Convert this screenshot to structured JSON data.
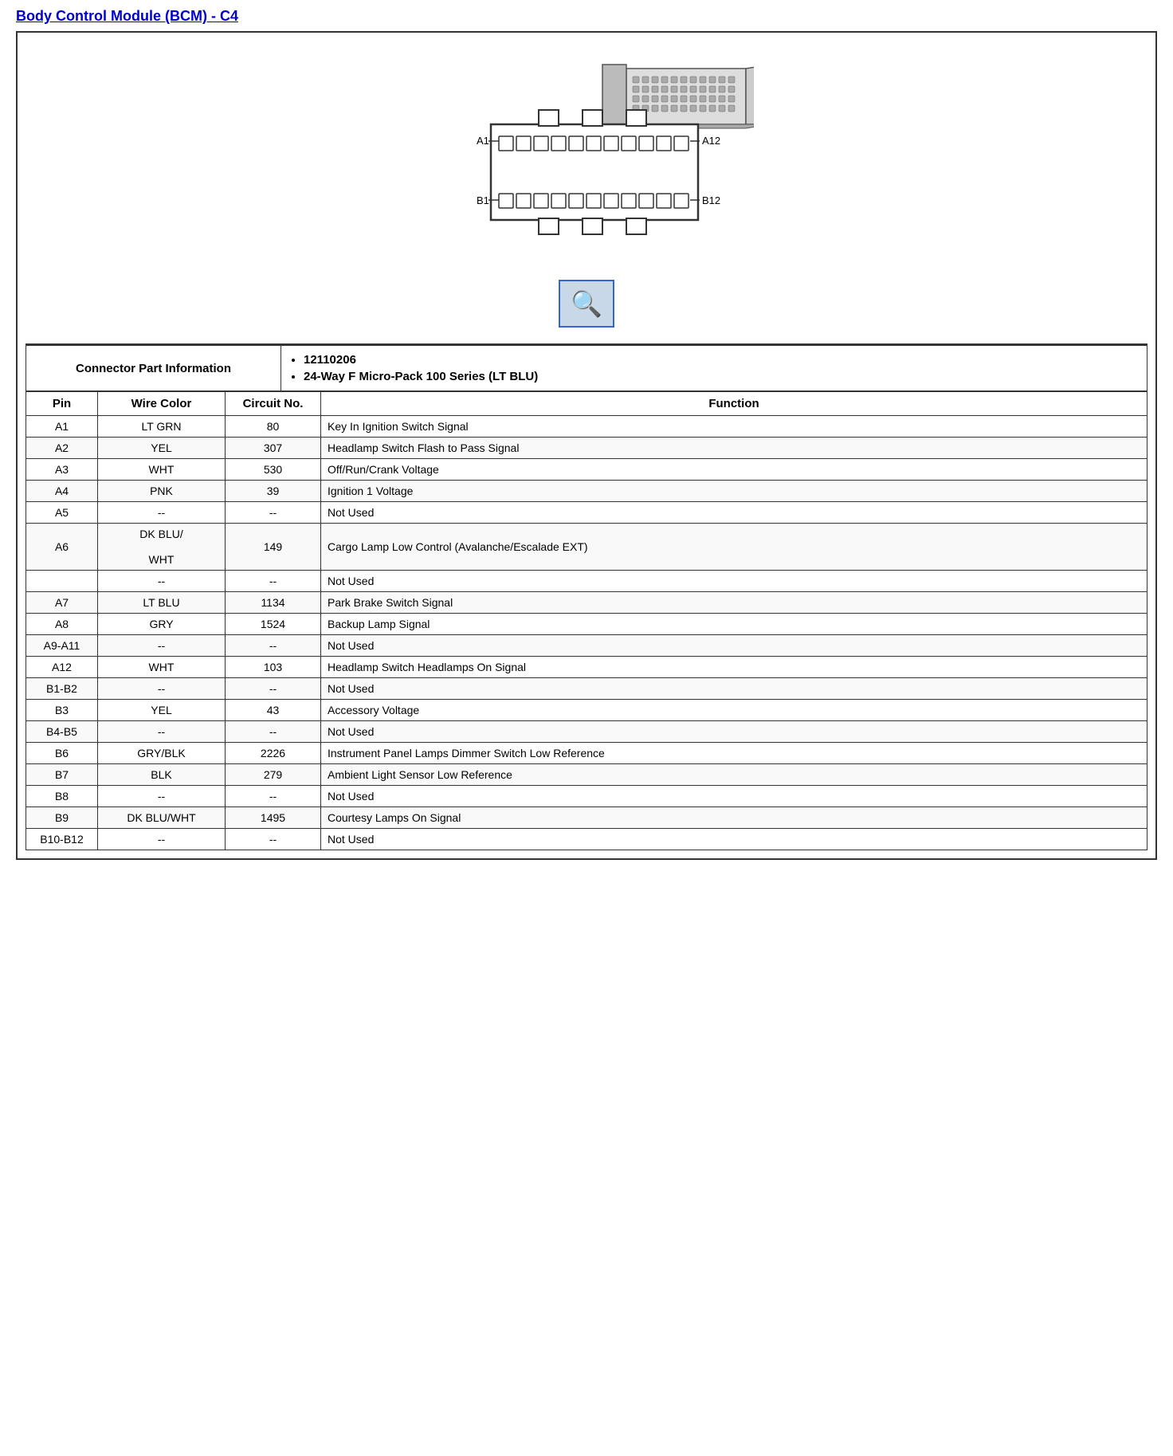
{
  "title": "Body Control Module (BCM) - C4",
  "connector_info_label": "Connector Part Information",
  "connector_details": [
    "12110206",
    "24-Way F Micro-Pack 100 Series (LT BLU)"
  ],
  "table_headers": {
    "pin": "Pin",
    "wire_color": "Wire Color",
    "circuit_no": "Circuit No.",
    "function": "Function"
  },
  "rows": [
    {
      "pin": "A1",
      "wire": "LT GRN",
      "circuit": "80",
      "func": "Key In Ignition Switch Signal"
    },
    {
      "pin": "A2",
      "wire": "YEL",
      "circuit": "307",
      "func": "Headlamp Switch Flash to Pass Signal"
    },
    {
      "pin": "A3",
      "wire": "WHT",
      "circuit": "530",
      "func": "Off/Run/Crank Voltage"
    },
    {
      "pin": "A4",
      "wire": "PNK",
      "circuit": "39",
      "func": "Ignition 1 Voltage"
    },
    {
      "pin": "A5",
      "wire": "--",
      "circuit": "--",
      "func": "Not Used"
    },
    {
      "pin": "A6",
      "wire": "DK BLU/\n\nWHT",
      "circuit": "149",
      "func": "Cargo Lamp Low Control (Avalanche/Escalade EXT)"
    },
    {
      "pin": "",
      "wire": "--",
      "circuit": "--",
      "func": "Not Used"
    },
    {
      "pin": "A7",
      "wire": "LT BLU",
      "circuit": "1134",
      "func": "Park Brake Switch Signal"
    },
    {
      "pin": "A8",
      "wire": "GRY",
      "circuit": "1524",
      "func": "Backup Lamp Signal"
    },
    {
      "pin": "A9-A11",
      "wire": "--",
      "circuit": "--",
      "func": "Not Used"
    },
    {
      "pin": "A12",
      "wire": "WHT",
      "circuit": "103",
      "func": "Headlamp Switch Headlamps On Signal"
    },
    {
      "pin": "B1-B2",
      "wire": "--",
      "circuit": "--",
      "func": "Not Used"
    },
    {
      "pin": "B3",
      "wire": "YEL",
      "circuit": "43",
      "func": "Accessory Voltage"
    },
    {
      "pin": "B4-B5",
      "wire": "--",
      "circuit": "--",
      "func": "Not Used"
    },
    {
      "pin": "B6",
      "wire": "GRY/BLK",
      "circuit": "2226",
      "func": "Instrument Panel Lamps Dimmer Switch Low Reference"
    },
    {
      "pin": "B7",
      "wire": "BLK",
      "circuit": "279",
      "func": "Ambient Light Sensor Low Reference"
    },
    {
      "pin": "B8",
      "wire": "--",
      "circuit": "--",
      "func": "Not Used"
    },
    {
      "pin": "B9",
      "wire": "DK BLU/WHT",
      "circuit": "1495",
      "func": "Courtesy Lamps On Signal"
    },
    {
      "pin": "B10-B12",
      "wire": "--",
      "circuit": "--",
      "func": "Not Used"
    }
  ]
}
